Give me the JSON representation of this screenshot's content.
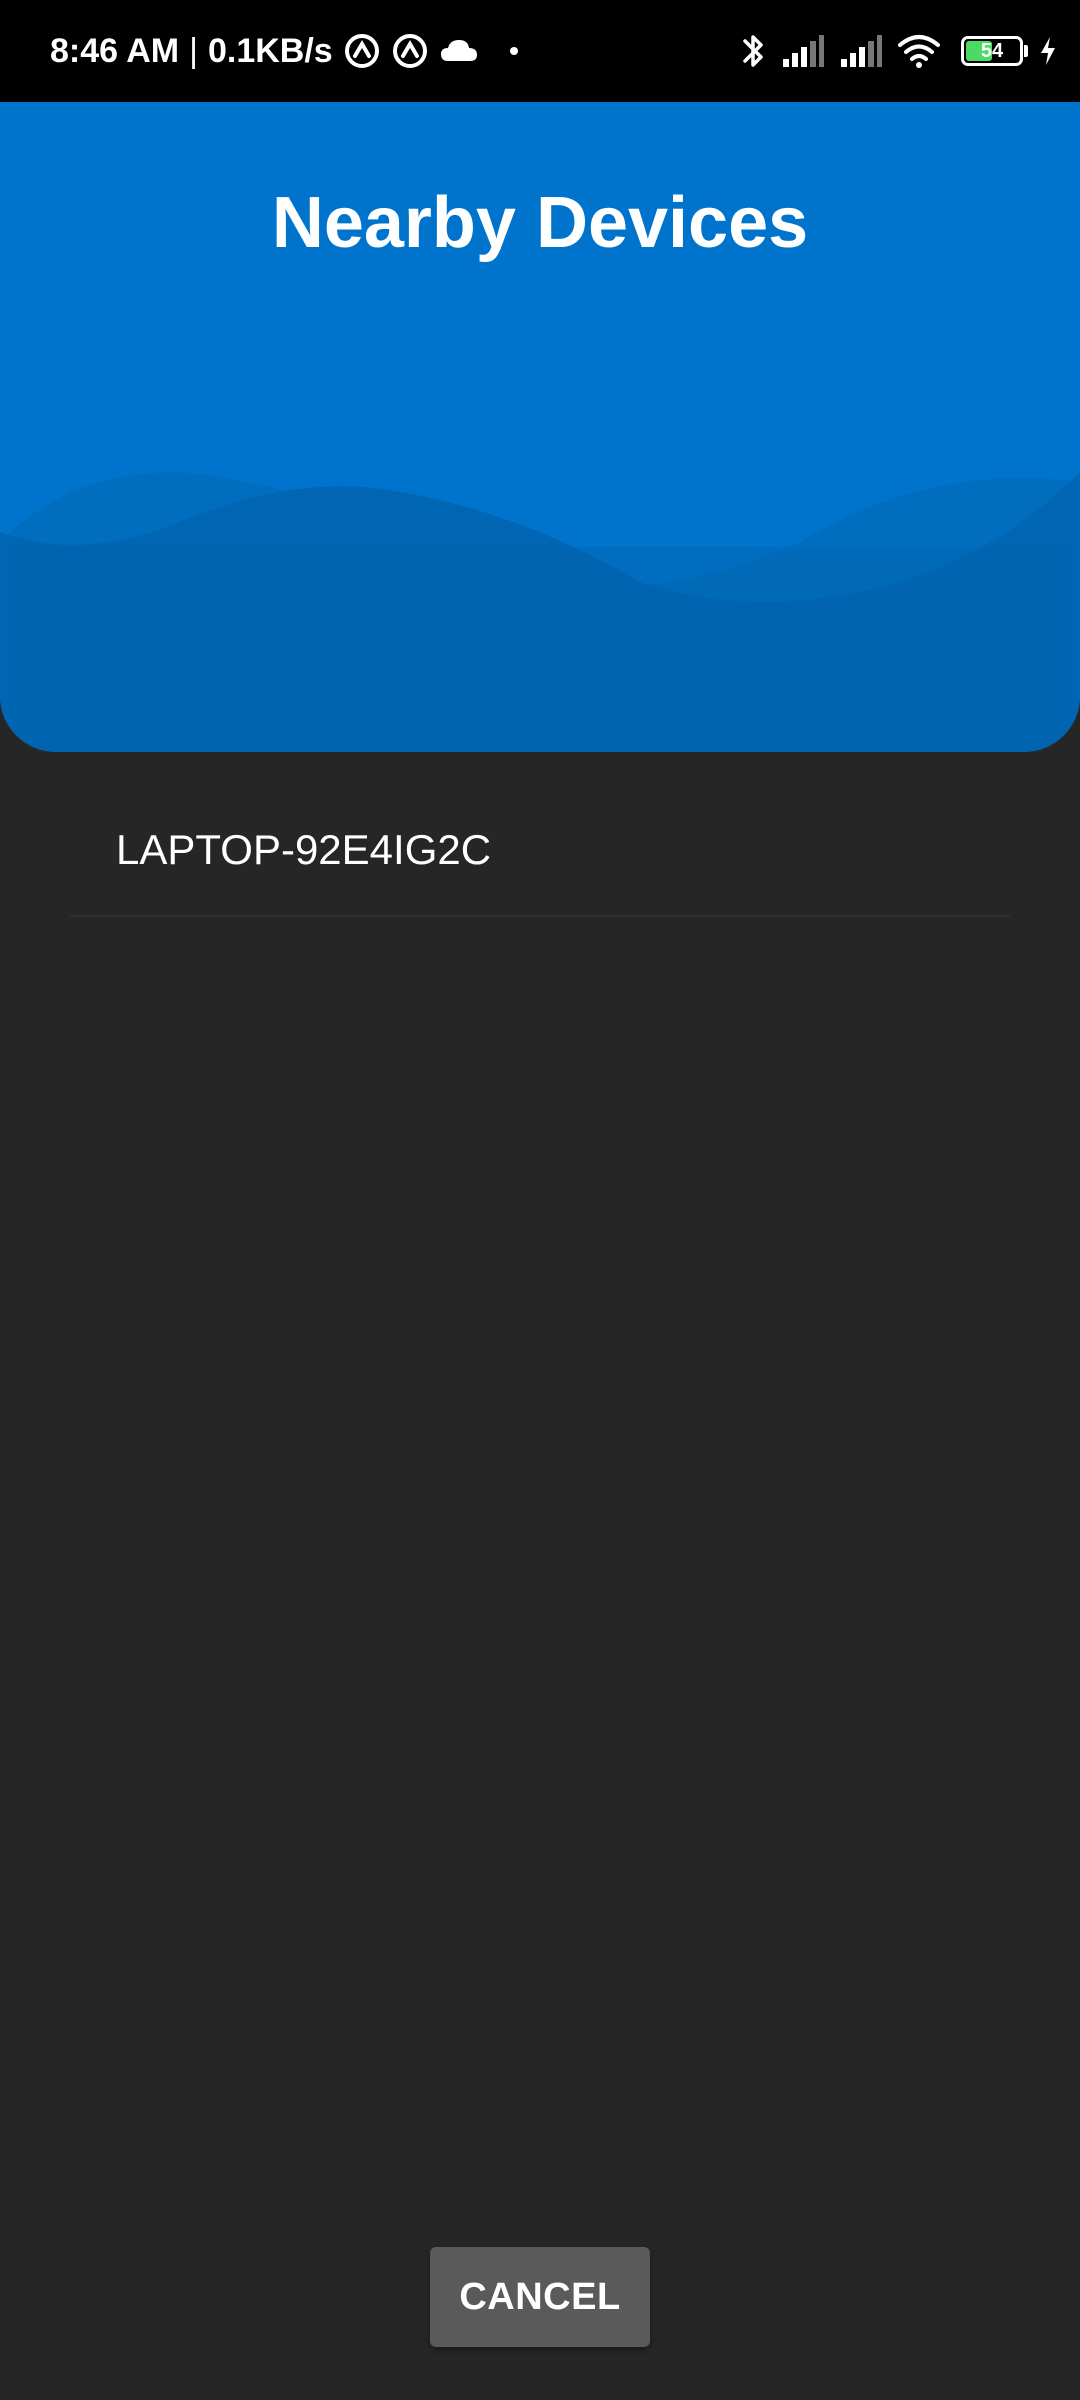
{
  "status_bar": {
    "time": "8:46 AM",
    "separator": "|",
    "network_speed": "0.1KB/s",
    "battery_level": "54",
    "battery_fraction": 0.54,
    "icons_left": [
      "sync-icon",
      "sync-icon",
      "cloud-icon",
      "dot-icon"
    ],
    "icons_right": [
      "bluetooth-icon",
      "signal-icon",
      "signal-icon",
      "wifi-icon",
      "battery-icon",
      "charging-icon"
    ]
  },
  "header": {
    "title": "Nearby Devices",
    "background_color": "#0074cc"
  },
  "devices": [
    {
      "name": "LAPTOP-92E4IG2C"
    }
  ],
  "footer": {
    "cancel_label": "CANCEL"
  }
}
